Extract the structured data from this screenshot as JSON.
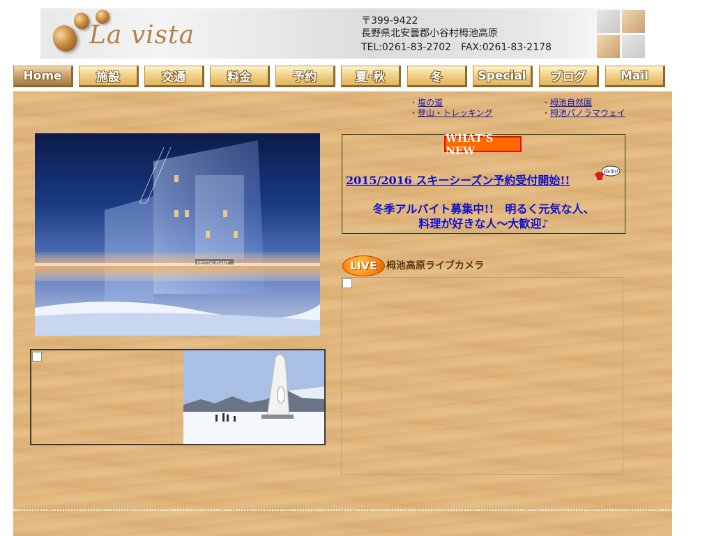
{
  "header": {
    "logo_text": "La vista",
    "postal": "〒399-9422",
    "address": "長野県北安曇郡小谷村栂池高原",
    "contact": "TEL:0261-83-2702　FAX:0261-83-2178"
  },
  "nav": {
    "items": [
      {
        "label": "Home"
      },
      {
        "label": "施設"
      },
      {
        "label": "交通"
      },
      {
        "label": "料金"
      },
      {
        "label": "予約"
      },
      {
        "label": "夏･秋"
      },
      {
        "label": "冬"
      },
      {
        "label": "Special"
      },
      {
        "label": "ブログ"
      },
      {
        "label": "Mail"
      }
    ]
  },
  "sublinks": {
    "col1": [
      "塩の道",
      "登山・トレッキング"
    ],
    "col2": [
      "栂池自然園",
      "栂池パノラマウェイ"
    ],
    "bullet": "・"
  },
  "news": {
    "badge": "WHAT'S NEW",
    "hello": "Hello!",
    "headline": "2015/2016 スキーシーズン予約受付開始!!",
    "line1": "冬季アルバイト募集中!!　明るく元気な人、",
    "line2": "料理が好きな人～大歓迎♪"
  },
  "live": {
    "badge": "LIVE",
    "title": "栂池高原ライブカメラ"
  },
  "photo": {
    "restaurant_sign": "RESTAURANT"
  },
  "colors": {
    "wood": "#e1b67c",
    "link": "#1a1aa8",
    "news_text": "#1010c8",
    "badge_orange": "#ff6a00"
  }
}
